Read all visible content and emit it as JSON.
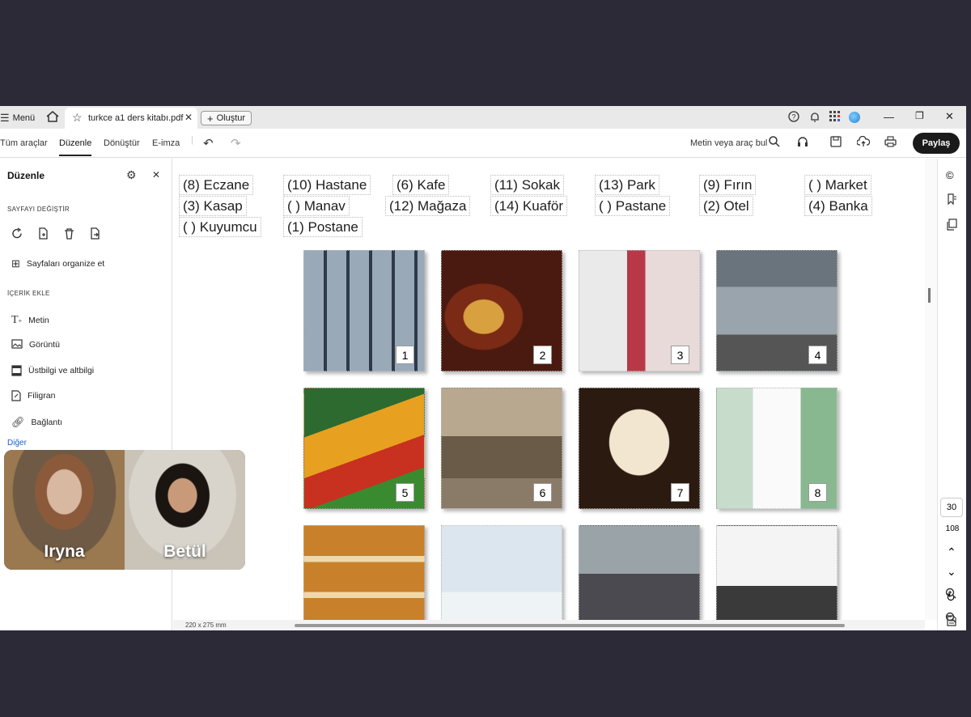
{
  "titlebar": {
    "menu_label": "Menü",
    "tab_title": "turkce a1 ders kitabı.pdf",
    "new_tab_label": "Oluştur"
  },
  "toolbar": {
    "items": [
      "Tüm araçlar",
      "Düzenle",
      "Dönüştür",
      "E-imza"
    ],
    "search_label": "Metin veya araç bul",
    "share_label": "Paylaş"
  },
  "sidebar": {
    "title": "Düzenle",
    "section_pages": "SAYFAYI DEĞİŞTİR",
    "organize_label": "Sayfaları organize et",
    "section_content": "İÇERİK EKLE",
    "items": [
      "Metin",
      "Görüntü",
      "Üstbilgi ve altbilgi",
      "Filigran",
      "Bağlantı"
    ],
    "more_label": "Diğer"
  },
  "document": {
    "words": [
      "(8) Eczane",
      "(10) Hastane",
      "(6) Kafe",
      "(11) Sokak",
      "(13) Park",
      "(9) Fırın",
      "(  ) Market",
      "(3) Kasap",
      "(  ) Manav",
      "(12) Mağaza",
      "(14) Kuaför",
      "(  ) Pastane",
      "(2) Otel",
      "(4) Banka",
      "(  ) Kuyumcu",
      "(1) Postane"
    ],
    "photo_numbers": [
      "1",
      "2",
      "3",
      "4",
      "5",
      "6",
      "7",
      "8"
    ],
    "page_size": "220 x 275 mm"
  },
  "rightbar": {
    "page_current": "30",
    "page_total": "108"
  },
  "video_call": {
    "participants": [
      "Iryna",
      "Betül"
    ]
  },
  "colors": {
    "titlebar_bg": "#e9e9e9",
    "share_bg": "#1a1a1a",
    "outer_bg": "#2c2a37"
  }
}
